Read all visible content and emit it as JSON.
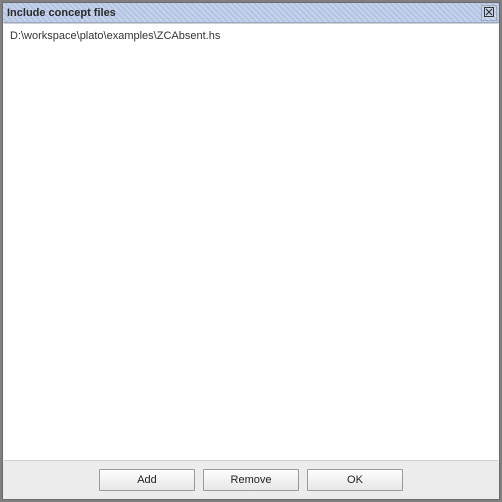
{
  "dialog": {
    "title": "Include concept files"
  },
  "list": {
    "items": [
      "D:\\workspace\\plato\\examples\\ZCAbsent.hs"
    ]
  },
  "buttons": {
    "add": "Add",
    "remove": "Remove",
    "ok": "OK"
  }
}
